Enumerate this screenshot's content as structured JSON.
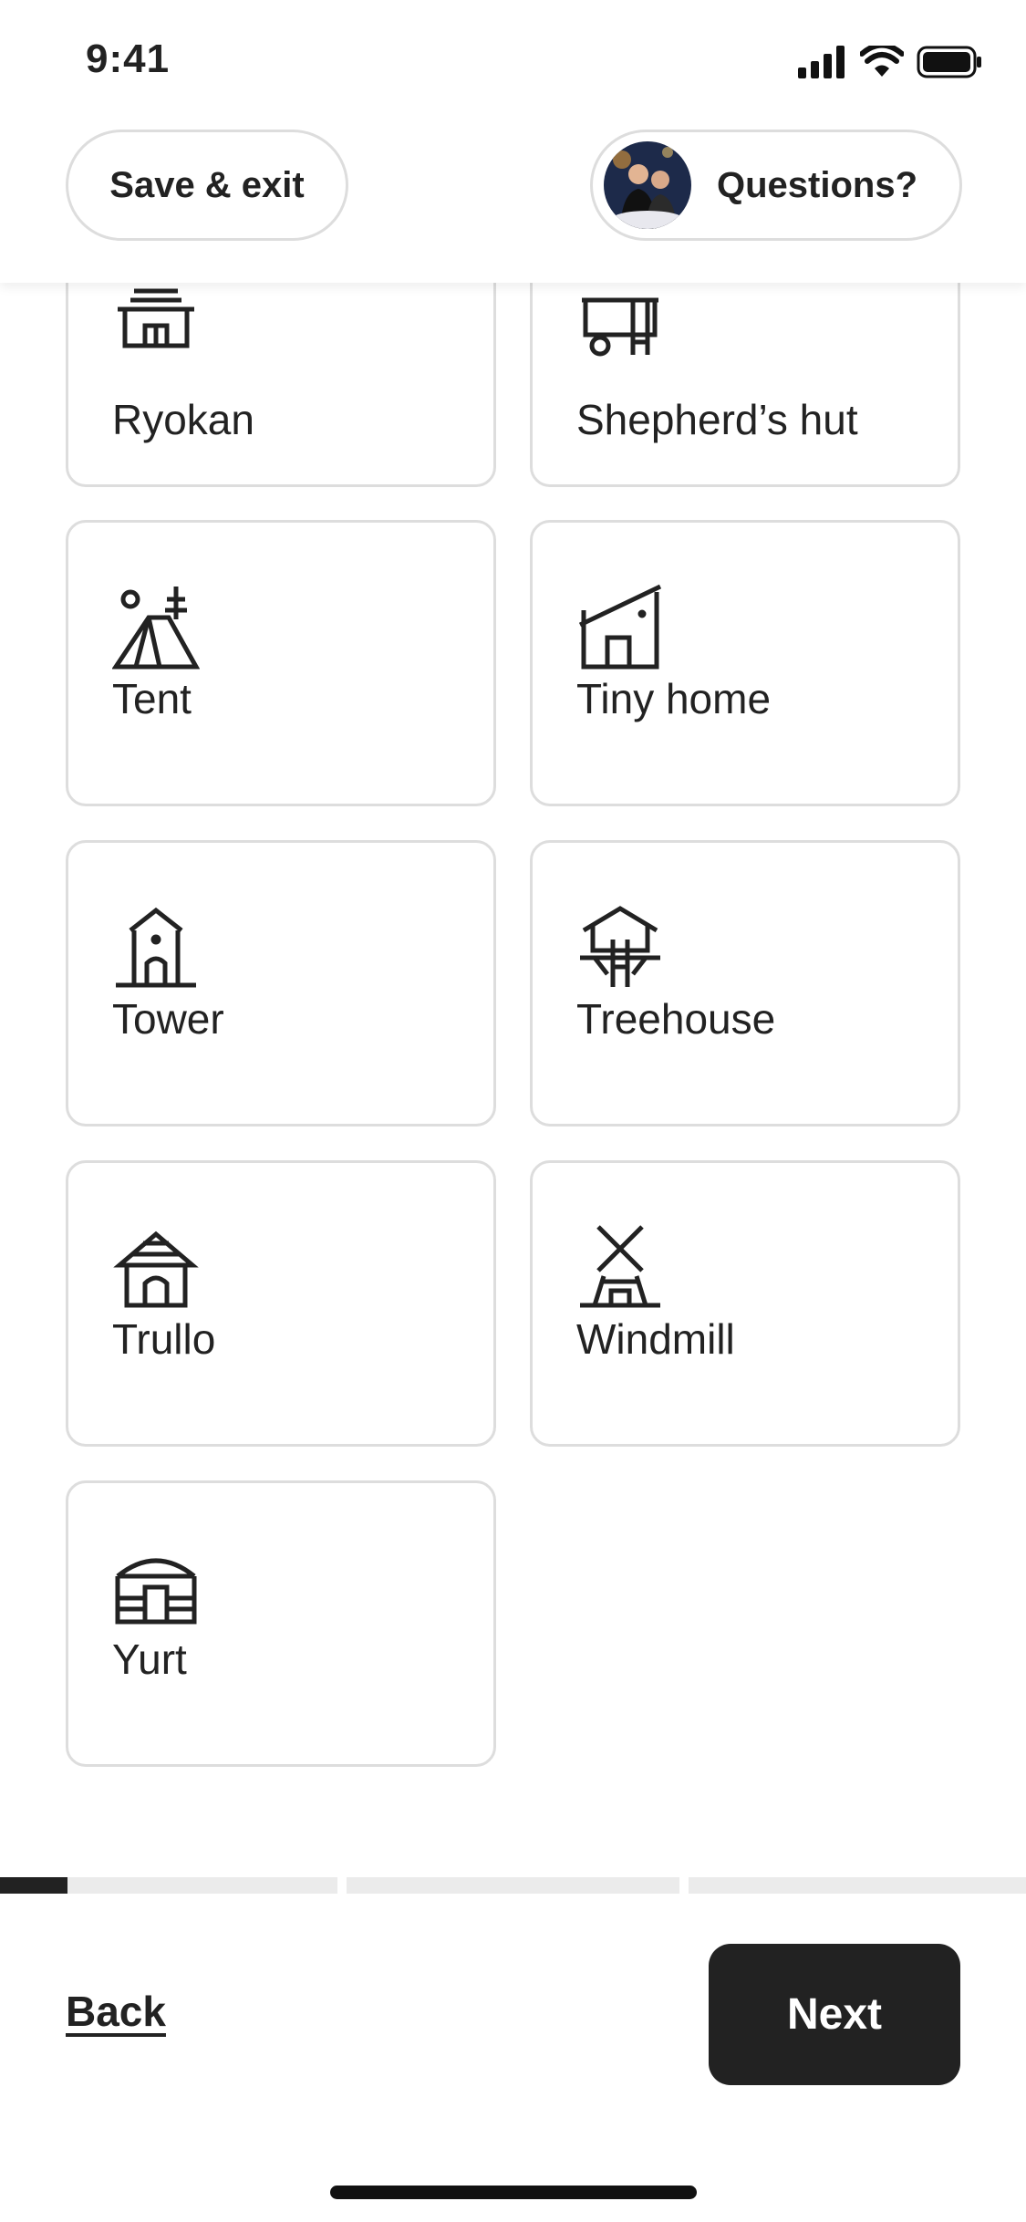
{
  "status_bar": {
    "time": "9:41",
    "icons": [
      "signal-icon",
      "wifi-icon",
      "battery-icon"
    ]
  },
  "header": {
    "save_exit_label": "Save & exit",
    "questions_label": "Questions?"
  },
  "property_types": [
    {
      "label": "Ryokan",
      "icon": "ryokan-icon"
    },
    {
      "label": "Shepherd’s hut",
      "icon": "shepherds-hut-icon"
    },
    {
      "label": "Tent",
      "icon": "tent-icon"
    },
    {
      "label": "Tiny home",
      "icon": "tiny-home-icon"
    },
    {
      "label": "Tower",
      "icon": "tower-icon"
    },
    {
      "label": "Treehouse",
      "icon": "treehouse-icon"
    },
    {
      "label": "Trullo",
      "icon": "trullo-icon"
    },
    {
      "label": "Windmill",
      "icon": "windmill-icon"
    },
    {
      "label": "Yurt",
      "icon": "yurt-icon"
    }
  ],
  "progress": {
    "step_fraction_filled": 0.2,
    "segments": 3
  },
  "footer": {
    "back_label": "Back",
    "next_label": "Next"
  },
  "colors": {
    "text": "#222222",
    "border": "#dddddd",
    "button": "#222222",
    "track": "#ebebeb"
  }
}
